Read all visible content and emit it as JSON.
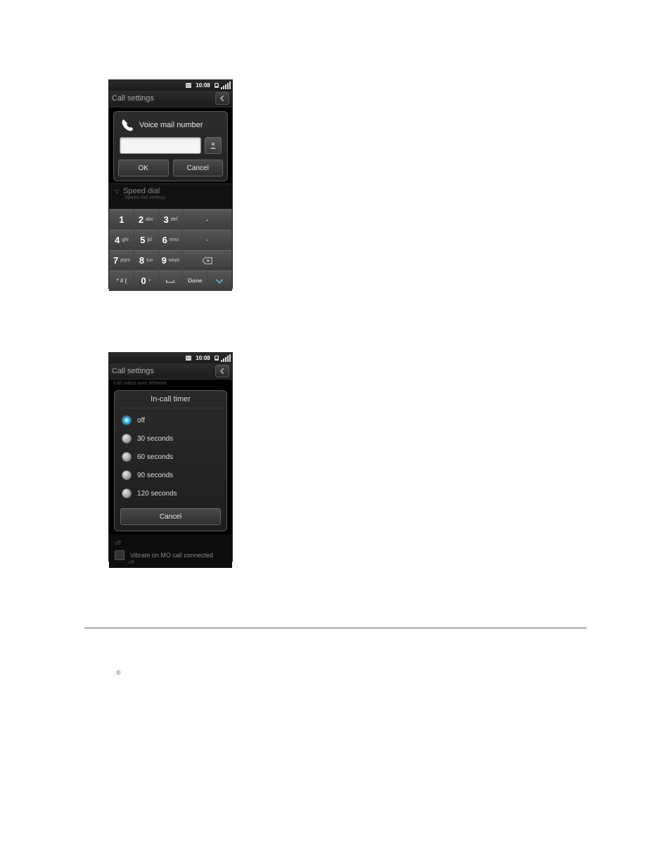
{
  "status": {
    "time": "10:08"
  },
  "titlebar": {
    "text": "Call settings"
  },
  "dialog1": {
    "title": "Voice mail number",
    "ok": "OK",
    "cancel": "Cancel"
  },
  "section1": {
    "title": "Speed dial",
    "sub": "Speed dial settings"
  },
  "keypad": {
    "r1": {
      "k1": {
        "n": "1",
        "l": ""
      },
      "k2": {
        "n": "2",
        "l": "abc"
      },
      "k3": {
        "n": "3",
        "l": "def"
      },
      "k4": {
        "l": "-"
      }
    },
    "r2": {
      "k1": {
        "n": "4",
        "l": "ghi"
      },
      "k2": {
        "n": "5",
        "l": "jkl"
      },
      "k3": {
        "n": "6",
        "l": "mno"
      },
      "k4": {
        "l": "·"
      }
    },
    "r3": {
      "k1": {
        "n": "7",
        "l": "pqrs"
      },
      "k2": {
        "n": "8",
        "l": "tuv"
      },
      "k3": {
        "n": "9",
        "l": "wxyz"
      },
      "k4": {
        "l": "DEL"
      }
    },
    "r4": {
      "k1": {
        "l": "* # ("
      },
      "k2": {
        "n": "0",
        "l": "+"
      },
      "k3": {
        "l": "␣"
      },
      "k4": {
        "l": "Done"
      }
    }
  },
  "sub2": {
    "text": "Call status tone Network"
  },
  "dialog2": {
    "title": "In-call timer",
    "options": {
      "o0": "off",
      "o1": "30 seconds",
      "o2": "60 seconds",
      "o3": "90 seconds",
      "o4": "120 seconds"
    },
    "cancel": "Cancel"
  },
  "below": {
    "off": "off",
    "vib": "Vibrate on MO call connected",
    "vibsub": "off"
  },
  "reg": "®"
}
